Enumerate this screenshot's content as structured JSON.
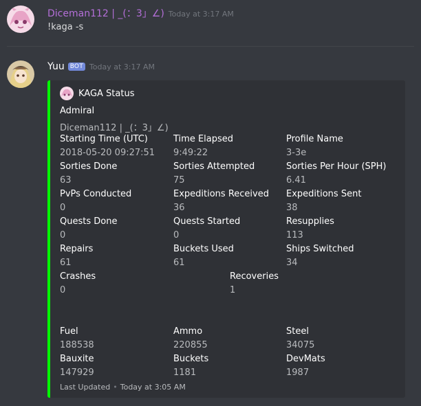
{
  "messages": [
    {
      "author": "Diceman112 | _(：3」∠)",
      "author_color": "#b46fd8",
      "timestamp": "Today at 3:17 AM",
      "text": "!kaga -s"
    },
    {
      "author": "Yuu",
      "author_color": "#ffffff",
      "bot_tag": "BOT",
      "timestamp": "Today at 3:17 AM"
    }
  ],
  "embed": {
    "color": "#00ff00",
    "author_name": "KAGA Status",
    "title": "Admiral",
    "description": "Diceman112 | _(：3」∠)",
    "fields": [
      {
        "name": "Starting Time (UTC)",
        "value": "2018-05-20 09:27:51"
      },
      {
        "name": "Time Elapsed",
        "value": "9:49:22"
      },
      {
        "name": "Profile Name",
        "value": "3-3e"
      },
      {
        "name": "Sorties Done",
        "value": "63"
      },
      {
        "name": "Sorties Attempted",
        "value": "75"
      },
      {
        "name": "Sorties Per Hour (SPH)",
        "value": "6.41"
      },
      {
        "name": "PvPs Conducted",
        "value": "0"
      },
      {
        "name": "Expeditions Received",
        "value": "36"
      },
      {
        "name": "Expeditions Sent",
        "value": "38"
      },
      {
        "name": "Quests Done",
        "value": "0"
      },
      {
        "name": "Quests Started",
        "value": "0"
      },
      {
        "name": "Resupplies",
        "value": "113"
      },
      {
        "name": "Repairs",
        "value": "61"
      },
      {
        "name": "Buckets Used",
        "value": "61"
      },
      {
        "name": "Ships Switched",
        "value": "34"
      },
      {
        "name": "Crashes",
        "value": "0"
      },
      {
        "name": "Recoveries",
        "value": "1"
      },
      {
        "name": "Fuel",
        "value": "188538"
      },
      {
        "name": "Ammo",
        "value": "220855"
      },
      {
        "name": "Steel",
        "value": "34075"
      },
      {
        "name": "Bauxite",
        "value": "147929"
      },
      {
        "name": "Buckets",
        "value": "1181"
      },
      {
        "name": "DevMats",
        "value": "1987"
      }
    ],
    "footer_label": "Last Updated",
    "footer_time": "Today at 3:05 AM"
  }
}
